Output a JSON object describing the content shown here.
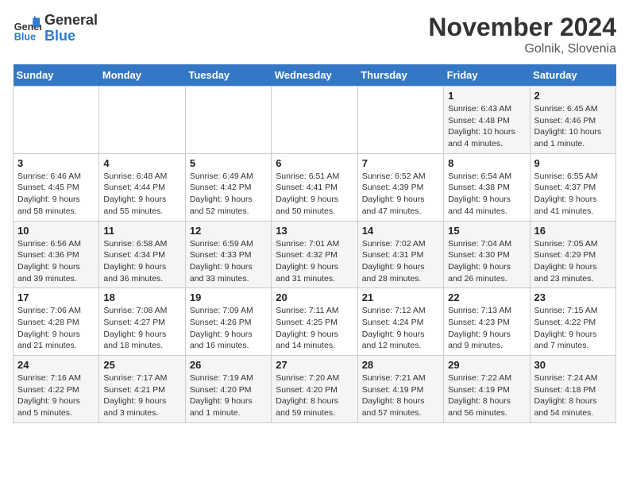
{
  "header": {
    "logo_line1": "General",
    "logo_line2": "Blue",
    "month": "November 2024",
    "location": "Golnik, Slovenia"
  },
  "weekdays": [
    "Sunday",
    "Monday",
    "Tuesday",
    "Wednesday",
    "Thursday",
    "Friday",
    "Saturday"
  ],
  "weeks": [
    [
      {
        "day": "",
        "info": ""
      },
      {
        "day": "",
        "info": ""
      },
      {
        "day": "",
        "info": ""
      },
      {
        "day": "",
        "info": ""
      },
      {
        "day": "",
        "info": ""
      },
      {
        "day": "1",
        "info": "Sunrise: 6:43 AM\nSunset: 4:48 PM\nDaylight: 10 hours\nand 4 minutes."
      },
      {
        "day": "2",
        "info": "Sunrise: 6:45 AM\nSunset: 4:46 PM\nDaylight: 10 hours\nand 1 minute."
      }
    ],
    [
      {
        "day": "3",
        "info": "Sunrise: 6:46 AM\nSunset: 4:45 PM\nDaylight: 9 hours\nand 58 minutes."
      },
      {
        "day": "4",
        "info": "Sunrise: 6:48 AM\nSunset: 4:44 PM\nDaylight: 9 hours\nand 55 minutes."
      },
      {
        "day": "5",
        "info": "Sunrise: 6:49 AM\nSunset: 4:42 PM\nDaylight: 9 hours\nand 52 minutes."
      },
      {
        "day": "6",
        "info": "Sunrise: 6:51 AM\nSunset: 4:41 PM\nDaylight: 9 hours\nand 50 minutes."
      },
      {
        "day": "7",
        "info": "Sunrise: 6:52 AM\nSunset: 4:39 PM\nDaylight: 9 hours\nand 47 minutes."
      },
      {
        "day": "8",
        "info": "Sunrise: 6:54 AM\nSunset: 4:38 PM\nDaylight: 9 hours\nand 44 minutes."
      },
      {
        "day": "9",
        "info": "Sunrise: 6:55 AM\nSunset: 4:37 PM\nDaylight: 9 hours\nand 41 minutes."
      }
    ],
    [
      {
        "day": "10",
        "info": "Sunrise: 6:56 AM\nSunset: 4:36 PM\nDaylight: 9 hours\nand 39 minutes."
      },
      {
        "day": "11",
        "info": "Sunrise: 6:58 AM\nSunset: 4:34 PM\nDaylight: 9 hours\nand 36 minutes."
      },
      {
        "day": "12",
        "info": "Sunrise: 6:59 AM\nSunset: 4:33 PM\nDaylight: 9 hours\nand 33 minutes."
      },
      {
        "day": "13",
        "info": "Sunrise: 7:01 AM\nSunset: 4:32 PM\nDaylight: 9 hours\nand 31 minutes."
      },
      {
        "day": "14",
        "info": "Sunrise: 7:02 AM\nSunset: 4:31 PM\nDaylight: 9 hours\nand 28 minutes."
      },
      {
        "day": "15",
        "info": "Sunrise: 7:04 AM\nSunset: 4:30 PM\nDaylight: 9 hours\nand 26 minutes."
      },
      {
        "day": "16",
        "info": "Sunrise: 7:05 AM\nSunset: 4:29 PM\nDaylight: 9 hours\nand 23 minutes."
      }
    ],
    [
      {
        "day": "17",
        "info": "Sunrise: 7:06 AM\nSunset: 4:28 PM\nDaylight: 9 hours\nand 21 minutes."
      },
      {
        "day": "18",
        "info": "Sunrise: 7:08 AM\nSunset: 4:27 PM\nDaylight: 9 hours\nand 18 minutes."
      },
      {
        "day": "19",
        "info": "Sunrise: 7:09 AM\nSunset: 4:26 PM\nDaylight: 9 hours\nand 16 minutes."
      },
      {
        "day": "20",
        "info": "Sunrise: 7:11 AM\nSunset: 4:25 PM\nDaylight: 9 hours\nand 14 minutes."
      },
      {
        "day": "21",
        "info": "Sunrise: 7:12 AM\nSunset: 4:24 PM\nDaylight: 9 hours\nand 12 minutes."
      },
      {
        "day": "22",
        "info": "Sunrise: 7:13 AM\nSunset: 4:23 PM\nDaylight: 9 hours\nand 9 minutes."
      },
      {
        "day": "23",
        "info": "Sunrise: 7:15 AM\nSunset: 4:22 PM\nDaylight: 9 hours\nand 7 minutes."
      }
    ],
    [
      {
        "day": "24",
        "info": "Sunrise: 7:16 AM\nSunset: 4:22 PM\nDaylight: 9 hours\nand 5 minutes."
      },
      {
        "day": "25",
        "info": "Sunrise: 7:17 AM\nSunset: 4:21 PM\nDaylight: 9 hours\nand 3 minutes."
      },
      {
        "day": "26",
        "info": "Sunrise: 7:19 AM\nSunset: 4:20 PM\nDaylight: 9 hours\nand 1 minute."
      },
      {
        "day": "27",
        "info": "Sunrise: 7:20 AM\nSunset: 4:20 PM\nDaylight: 8 hours\nand 59 minutes."
      },
      {
        "day": "28",
        "info": "Sunrise: 7:21 AM\nSunset: 4:19 PM\nDaylight: 8 hours\nand 57 minutes."
      },
      {
        "day": "29",
        "info": "Sunrise: 7:22 AM\nSunset: 4:19 PM\nDaylight: 8 hours\nand 56 minutes."
      },
      {
        "day": "30",
        "info": "Sunrise: 7:24 AM\nSunset: 4:18 PM\nDaylight: 8 hours\nand 54 minutes."
      }
    ]
  ]
}
